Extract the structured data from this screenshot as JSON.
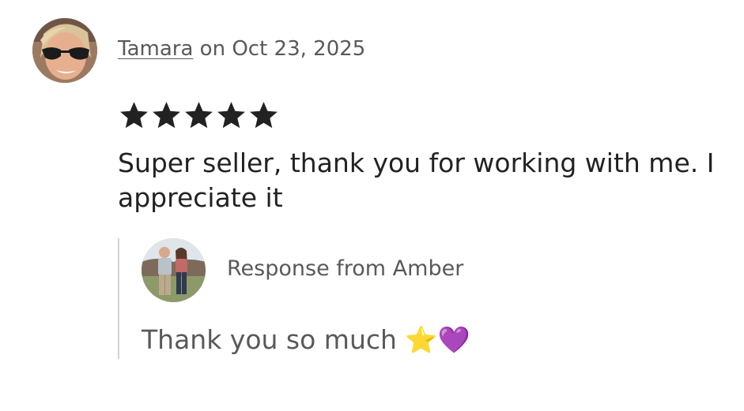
{
  "review": {
    "reviewer_name": "Tamara",
    "date_text": "on Oct 23, 2025",
    "rating": 5,
    "rating_max": 5,
    "star_color": "#222222",
    "text": "Super seller, thank you for working with me. I appreciate it"
  },
  "response": {
    "label": "Response from Amber",
    "text": "Thank you so much ⭐💜"
  }
}
